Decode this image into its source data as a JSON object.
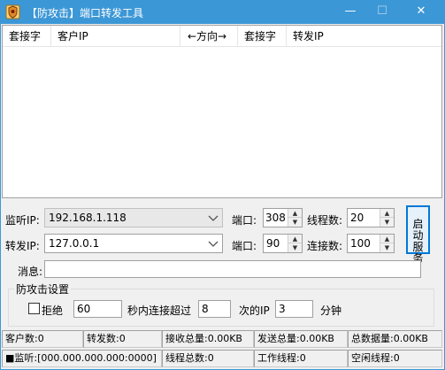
{
  "window": {
    "title": "【防攻击】端口转发工具",
    "icon": "bug-shield-icon",
    "minimize": "—",
    "maximize": "☐",
    "close": "✕",
    "titlebar_color": "#3c97d6"
  },
  "list": {
    "columns": [
      "套接字",
      "客户IP",
      "←方向→",
      "套接字",
      "转发IP"
    ]
  },
  "listen": {
    "ip_label": "监听IP:",
    "ip_value": "192.168.1.118",
    "port_label": "端口:",
    "port_value": "308",
    "threads_label": "线程数:",
    "threads_value": "20"
  },
  "forward": {
    "ip_label": "转发IP:",
    "ip_value": "127.0.0.1",
    "port_label": "端口:",
    "port_value": "90",
    "connections_label": "连接数:",
    "connections_value": "100"
  },
  "start_button": {
    "line1": "启动",
    "line2": "服务"
  },
  "message": {
    "label": "消息:",
    "value": ""
  },
  "protection": {
    "title": "防攻击设置",
    "reject_label": "拒绝",
    "reject_checked": false,
    "seconds_value": "60",
    "seconds_text": "秒内连接超过",
    "times_value": "8",
    "times_text": "次的IP",
    "minutes_value": "3",
    "minutes_text": "分钟"
  },
  "status_row1": {
    "clients": "客户数:0",
    "forwards": "转发数:0",
    "received": "接收总量:0.00KB",
    "sent": "发送总量:0.00KB",
    "total": "总数据量:0.00KB"
  },
  "status_row2": {
    "listen": "■监听:[000.000.000.000:0000]",
    "threads_total": "线程总数:0",
    "working_threads": "工作线程:0",
    "idle_threads": "空闲线程:0"
  }
}
